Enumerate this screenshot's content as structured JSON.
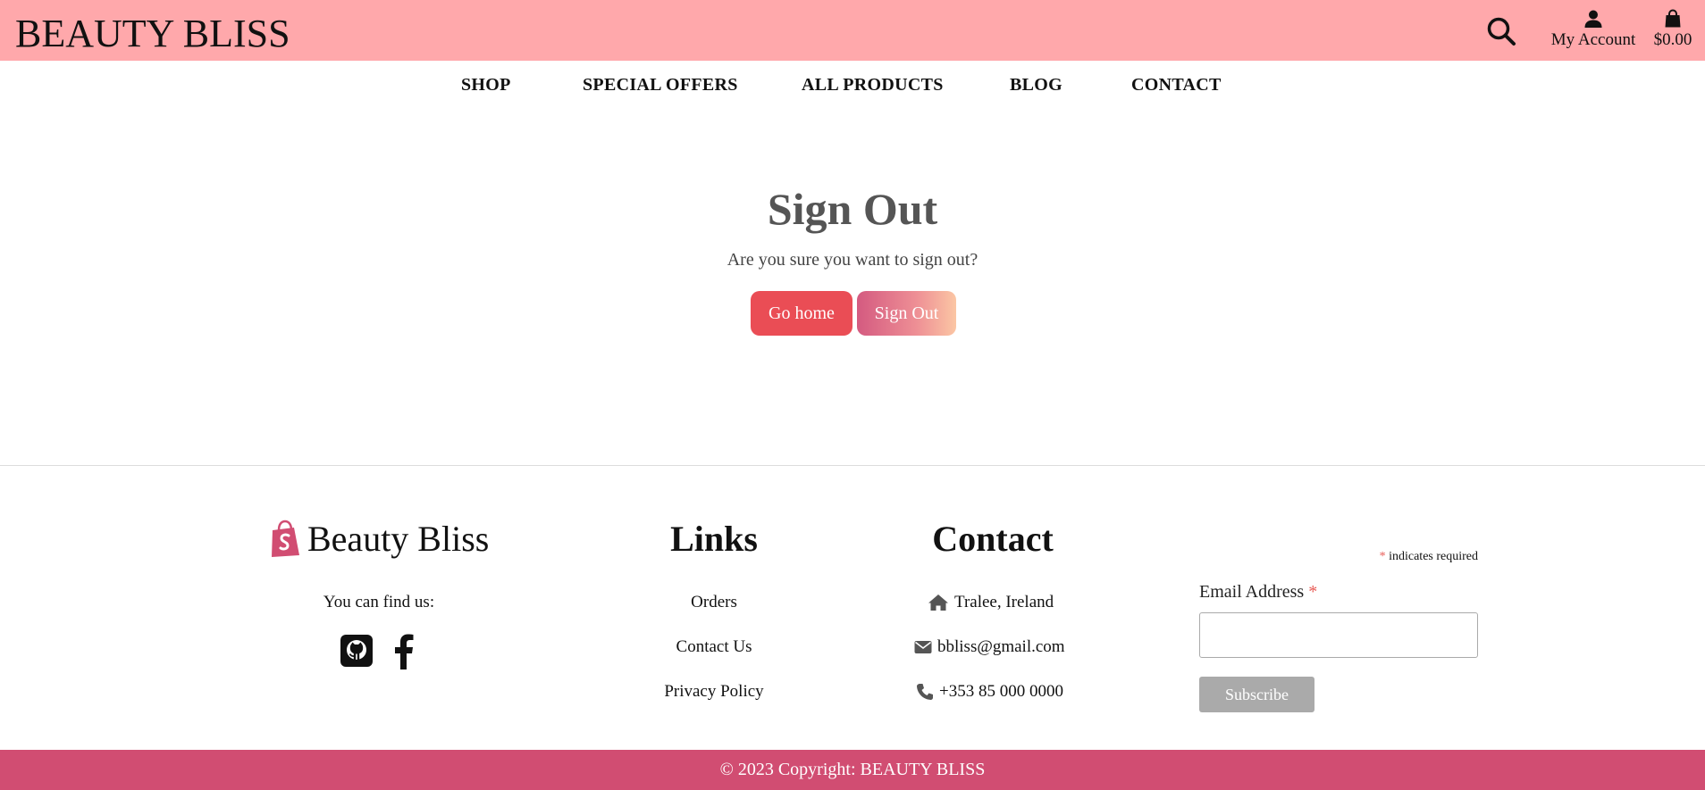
{
  "header": {
    "brand": "BEAUTY BLISS",
    "account_label": "My Account",
    "cart_total": "$0.00"
  },
  "nav": {
    "items": [
      "SHOP",
      "SPECIAL OFFERS",
      "ALL PRODUCTS",
      "BLOG",
      "CONTACT"
    ]
  },
  "main": {
    "title": "Sign Out",
    "subtitle": "Are you sure you want to sign out?",
    "go_home_label": "Go home",
    "sign_out_label": "Sign Out"
  },
  "footer": {
    "brand_name": "Beauty Bliss",
    "find_us": "You can find us:",
    "social_icons": [
      "github-icon",
      "facebook-icon"
    ],
    "links_title": "Links",
    "links": [
      "Orders",
      "Contact Us",
      "Privacy Policy"
    ],
    "contact_title": "Contact",
    "address": "Tralee, Ireland",
    "email": "bbliss@gmail.com",
    "phone": "+353 85 000 0000",
    "required_marker": "*",
    "required_note": " indicates required",
    "email_label": "Email Address",
    "email_value": "",
    "subscribe_label": "Subscribe",
    "copyright": "© 2023 Copyright: BEAUTY BLISS"
  },
  "colors": {
    "header_bg": "#ffa8ab",
    "go_home_bg": "#ea4d55",
    "footer_bar_bg": "#d14d72",
    "required_asterisk": "#e85b55"
  }
}
